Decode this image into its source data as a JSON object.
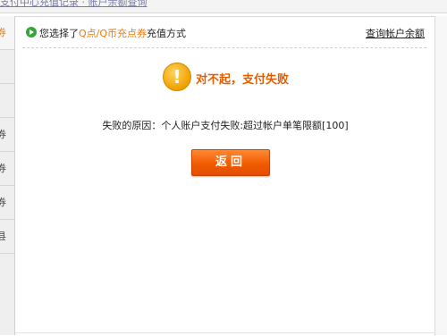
{
  "top_link": "支付中心充值记录 · 账户余额查询",
  "sidebar": {
    "items": [
      {
        "label": "券"
      },
      {
        "label": ")"
      },
      {
        "label": ")"
      },
      {
        "label": "券"
      },
      {
        "label": "券"
      },
      {
        "label": "券"
      },
      {
        "label": "县"
      }
    ]
  },
  "header": {
    "prefix": "您选择了",
    "method": "Q点/Q币充点券",
    "suffix": "充值方式",
    "query_link": "查询帐户余额"
  },
  "result": {
    "icon": "warning-exclamation-icon",
    "icon_glyph": "!",
    "title": "对不起，支付失败",
    "reason": "失败的原因：个人账户支付失败:超过帐户单笔限额[100]"
  },
  "back_button": "返回",
  "colors": {
    "accent_orange": "#e87b12",
    "button_orange": "#f25b00",
    "title_orange": "#e25e00",
    "green_icon": "#3aa33a"
  }
}
